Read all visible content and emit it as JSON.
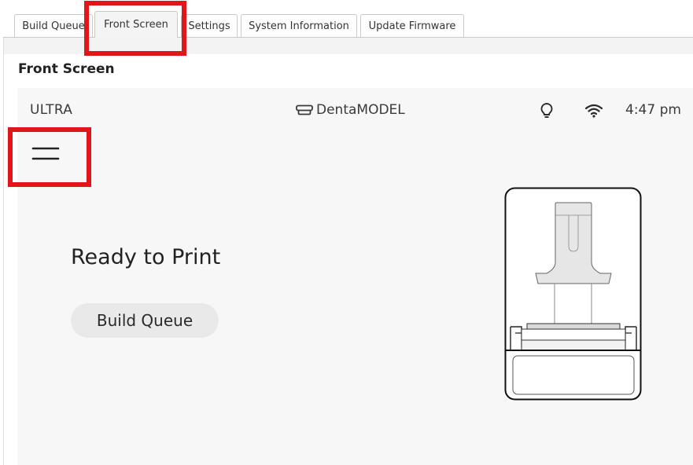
{
  "tabs": [
    {
      "label": "Build Queue"
    },
    {
      "label": "Front Screen"
    },
    {
      "label": "Settings"
    },
    {
      "label": "System Information"
    },
    {
      "label": "Update Firmware"
    }
  ],
  "panel": {
    "title": "Front Screen"
  },
  "device": {
    "status_bar": {
      "model": "ULTRA",
      "material": "DentaMODEL",
      "time": "4:47 pm",
      "icons": [
        "resin-tray-icon",
        "lightbulb-icon",
        "wifi-icon"
      ]
    },
    "menu_icon": "hamburger-menu-icon",
    "status_message": "Ready to Print",
    "primary_button": "Build Queue",
    "illustration": "printer-illustration"
  },
  "colors": {
    "highlight": "#e0161b",
    "screen_bg": "#f7f7f7",
    "pill_bg": "#e9e9e9"
  }
}
